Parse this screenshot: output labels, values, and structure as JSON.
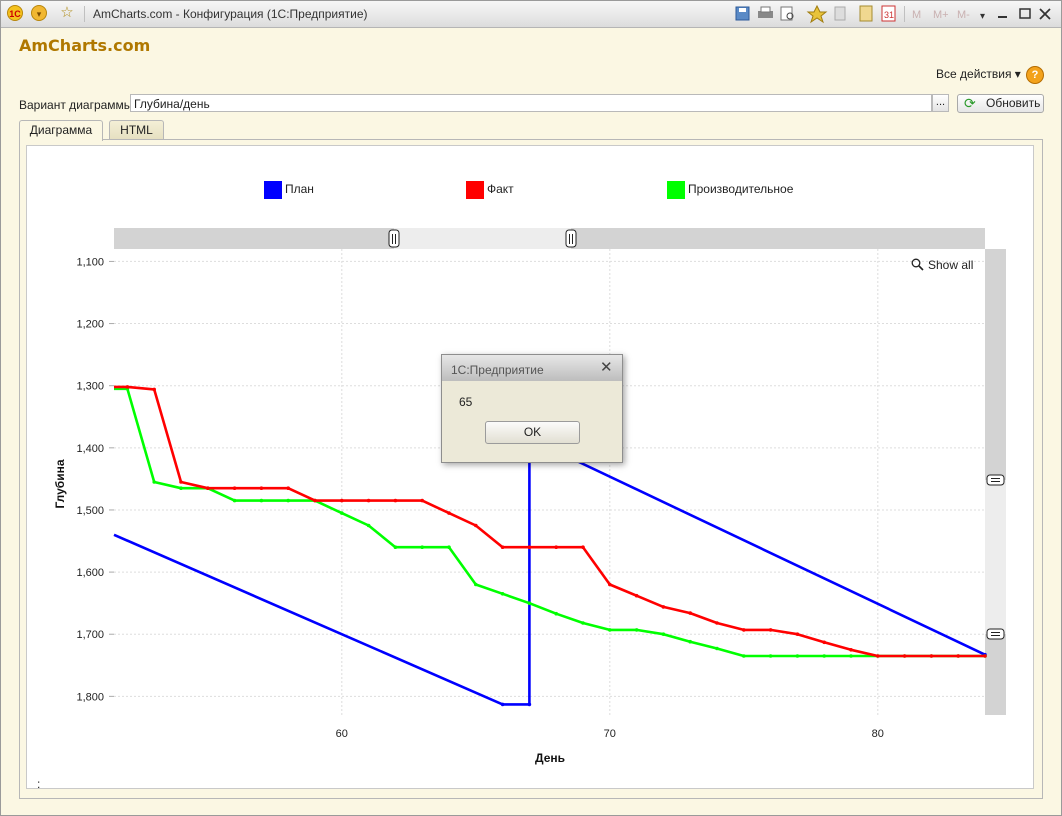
{
  "window": {
    "title": "AmCharts.com - Конфигурация  (1С:Предприятие)",
    "toolbar_icons": [
      "1c-logo-icon",
      "main-menu-icon",
      "favorite-star-icon",
      "save-icon",
      "print-icon",
      "preview-icon",
      "add-favorite-icon",
      "history-icon",
      "calculator-icon",
      "calendar-icon",
      "m-icon",
      "m-plus-icon",
      "m-minus-icon",
      "dropdown-icon",
      "minimize-icon",
      "maximize-icon",
      "close-icon"
    ],
    "m_label": "M",
    "mplus_label": "M+",
    "mminus_label": "M-"
  },
  "app": {
    "title": "AmCharts.com",
    "all_actions": "Все действия ▾",
    "help": "?"
  },
  "form": {
    "variant_label": "Вариант диаграммы:",
    "variant_value": "Глубина/день",
    "select_btn": "...",
    "refresh_label": "Обновить",
    "tabs": [
      "Диаграмма",
      "HTML"
    ]
  },
  "chart": {
    "show_all": "Show all",
    "footer_text": ":",
    "legend": [
      {
        "label": "План",
        "color": "#0000ff"
      },
      {
        "label": "Факт",
        "color": "#ff0000"
      },
      {
        "label": "Производительное",
        "color": "#00ff00"
      }
    ]
  },
  "chart_data": {
    "type": "line",
    "xlabel": "День",
    "ylabel": "Глубина",
    "x_ticks": [
      60,
      70,
      80
    ],
    "y_ticks": [
      "1,100",
      "1,200",
      "1,300",
      "1,400",
      "1,500",
      "1,600",
      "1,700",
      "1,800"
    ],
    "xlim": [
      51.5,
      84
    ],
    "ylim": [
      1080,
      1830
    ],
    "y_reversed": true,
    "grid": true,
    "legend_position": "top",
    "series": [
      {
        "name": "План",
        "color": "#0000ff",
        "points": [
          [
            51.5,
            1540
          ],
          [
            66,
            1813
          ],
          [
            67,
            1813
          ],
          [
            67,
            1385
          ],
          [
            84,
            1733
          ]
        ]
      },
      {
        "name": "Факт",
        "color": "#ff0000",
        "points": [
          [
            51.5,
            1302
          ],
          [
            52,
            1302
          ],
          [
            53,
            1306
          ],
          [
            54,
            1455
          ],
          [
            55,
            1465
          ],
          [
            56,
            1465
          ],
          [
            57,
            1465
          ],
          [
            58,
            1465
          ],
          [
            59,
            1485
          ],
          [
            60,
            1485
          ],
          [
            61,
            1485
          ],
          [
            62,
            1485
          ],
          [
            63,
            1485
          ],
          [
            64,
            1505
          ],
          [
            65,
            1525
          ],
          [
            66,
            1560
          ],
          [
            67,
            1560
          ],
          [
            68,
            1560
          ],
          [
            69,
            1560
          ],
          [
            70,
            1620
          ],
          [
            71,
            1638
          ],
          [
            72,
            1656
          ],
          [
            73,
            1666
          ],
          [
            74,
            1682
          ],
          [
            75,
            1693
          ],
          [
            76,
            1693
          ],
          [
            77,
            1700
          ],
          [
            78,
            1713
          ],
          [
            79,
            1725
          ],
          [
            80,
            1735
          ],
          [
            81,
            1735
          ],
          [
            82,
            1735
          ],
          [
            83,
            1735
          ],
          [
            84,
            1735
          ]
        ]
      },
      {
        "name": "Производительное",
        "color": "#00ff00",
        "points": [
          [
            51.5,
            1305
          ],
          [
            52,
            1305
          ],
          [
            53,
            1455
          ],
          [
            54,
            1465
          ],
          [
            55,
            1465
          ],
          [
            56,
            1485
          ],
          [
            57,
            1485
          ],
          [
            58,
            1485
          ],
          [
            59,
            1485
          ],
          [
            60,
            1505
          ],
          [
            61,
            1525
          ],
          [
            62,
            1560
          ],
          [
            63,
            1560
          ],
          [
            64,
            1560
          ],
          [
            65,
            1620
          ],
          [
            66,
            1635
          ],
          [
            67,
            1650
          ],
          [
            68,
            1667
          ],
          [
            69,
            1682
          ],
          [
            70,
            1693
          ],
          [
            71,
            1693
          ],
          [
            72,
            1700
          ],
          [
            73,
            1712
          ],
          [
            74,
            1723
          ],
          [
            75,
            1735
          ],
          [
            76,
            1735
          ],
          [
            77,
            1735
          ],
          [
            78,
            1735
          ],
          [
            79,
            1735
          ],
          [
            80,
            1735
          ],
          [
            81,
            1735
          ],
          [
            82,
            1735
          ],
          [
            83,
            1735
          ],
          [
            84,
            1735
          ]
        ]
      }
    ]
  },
  "dialog": {
    "title": "1С:Предприятие",
    "message": "65",
    "ok": "OK"
  }
}
